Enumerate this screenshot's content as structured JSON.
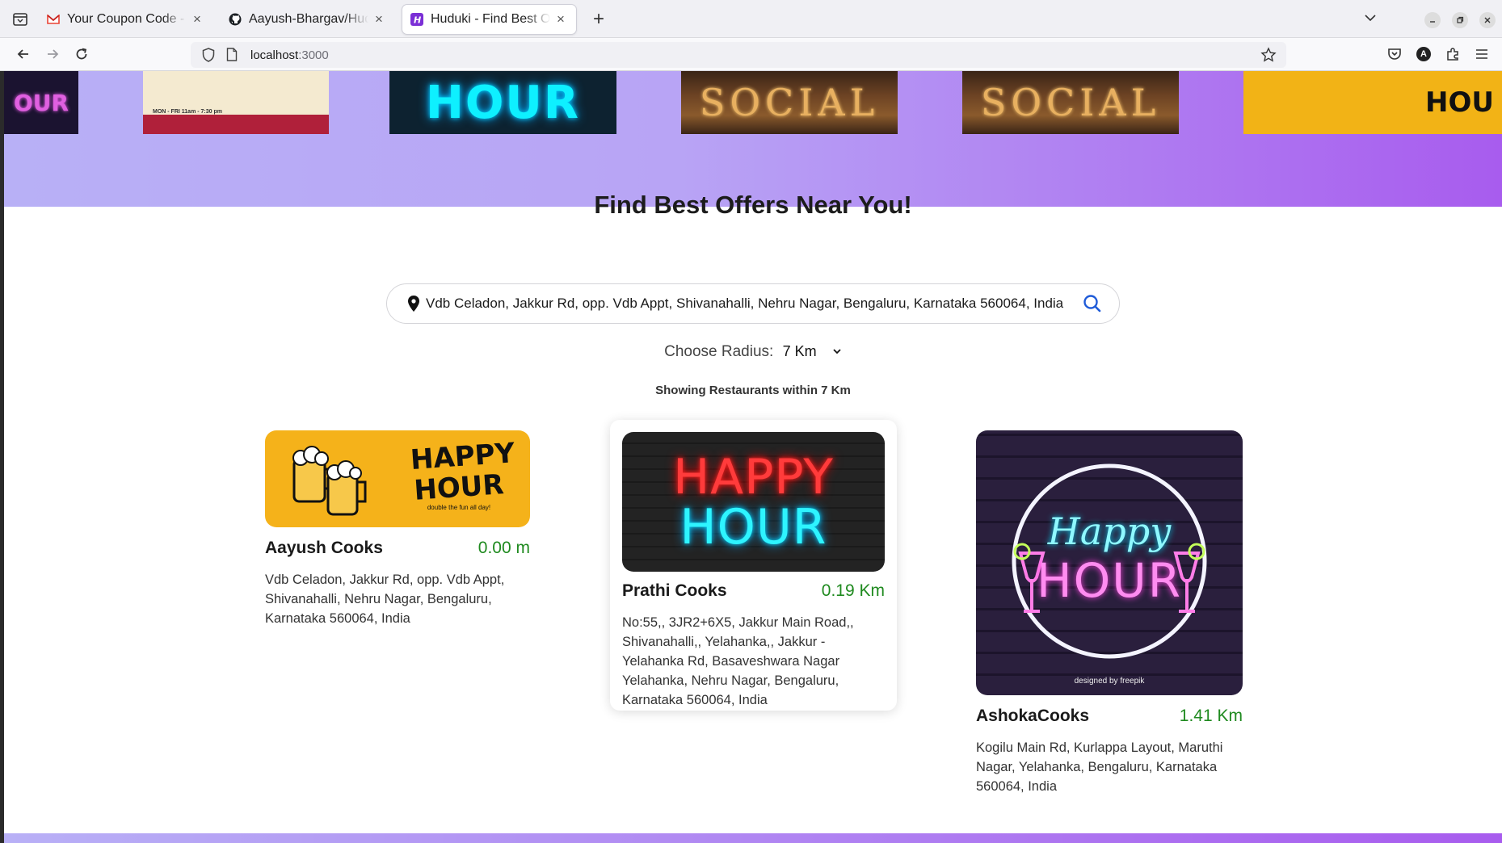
{
  "browser": {
    "tabs": [
      {
        "title": "Your Coupon Code - aayush",
        "favicon": "gmail-icon",
        "active": false
      },
      {
        "title": "Aayush-Bhargav/Huduki-Find",
        "favicon": "github-icon",
        "active": false
      },
      {
        "title": "Huduki - Find Best Offers",
        "favicon": "huduki-icon",
        "active": true
      }
    ],
    "close_glyph": "×",
    "new_tab_glyph": "+",
    "url_host": "localhost",
    "url_port": ":3000",
    "account_initial": "A"
  },
  "hero": {
    "banners": [
      {
        "kind": "neon-partial",
        "text": "OUR"
      },
      {
        "kind": "poster",
        "text": "MON - FRI 11am - 7:30 pm"
      },
      {
        "kind": "neon",
        "text": "HOUR"
      },
      {
        "kind": "social",
        "text": "SOCIAL"
      },
      {
        "kind": "social",
        "text": "SOCIAL"
      },
      {
        "kind": "yellow",
        "text": "HOU"
      }
    ],
    "colors": {
      "start": "#b8b0f6",
      "end": "#a85cee"
    }
  },
  "main": {
    "heading": "Find Best Offers Near You!",
    "search_value": "Vdb Celadon, Jakkur Rd, opp. Vdb Appt, Shivanahalli, Nehru Nagar, Bengaluru, Karnataka 560064, India",
    "radius_label": "Choose Radius:",
    "radius_value": "7 Km",
    "showing_text": "Showing Restaurants within 7 Km"
  },
  "restaurants": [
    {
      "name": "Aayush Cooks",
      "distance": "0.00 m",
      "address": "Vdb Celadon, Jakkur Rd, opp. Vdb Appt, Shivanahalli, Nehru Nagar, Bengaluru, Karnataka 560064, India",
      "image_text": [
        "HAPPY",
        "HOUR"
      ],
      "image_subtext": "double the fun all day!"
    },
    {
      "name": "Prathi Cooks",
      "distance": "0.19 Km",
      "address": "No:55,, 3JR2+6X5, Jakkur Main Road,, Shivanahalli,, Yelahanka,, Jakkur - Yelahanka Rd, Basaveshwara Nagar Yelahanka, Nehru Nagar, Bengaluru, Karnataka 560064, India",
      "image_text": [
        "HAPPY",
        "HOUR"
      ]
    },
    {
      "name": "AshokaCooks",
      "distance": "1.41 Km",
      "address": "Kogilu Main Rd, Kurlappa Layout, Maruthi Nagar, Yelahanka, Bengaluru, Karnataka 560064, India",
      "image_text": [
        "Happy",
        "HOUR"
      ],
      "image_subtext": "designed by freepik"
    }
  ],
  "colors": {
    "distance": "#1f8a1f",
    "accent": "#a85cee"
  }
}
